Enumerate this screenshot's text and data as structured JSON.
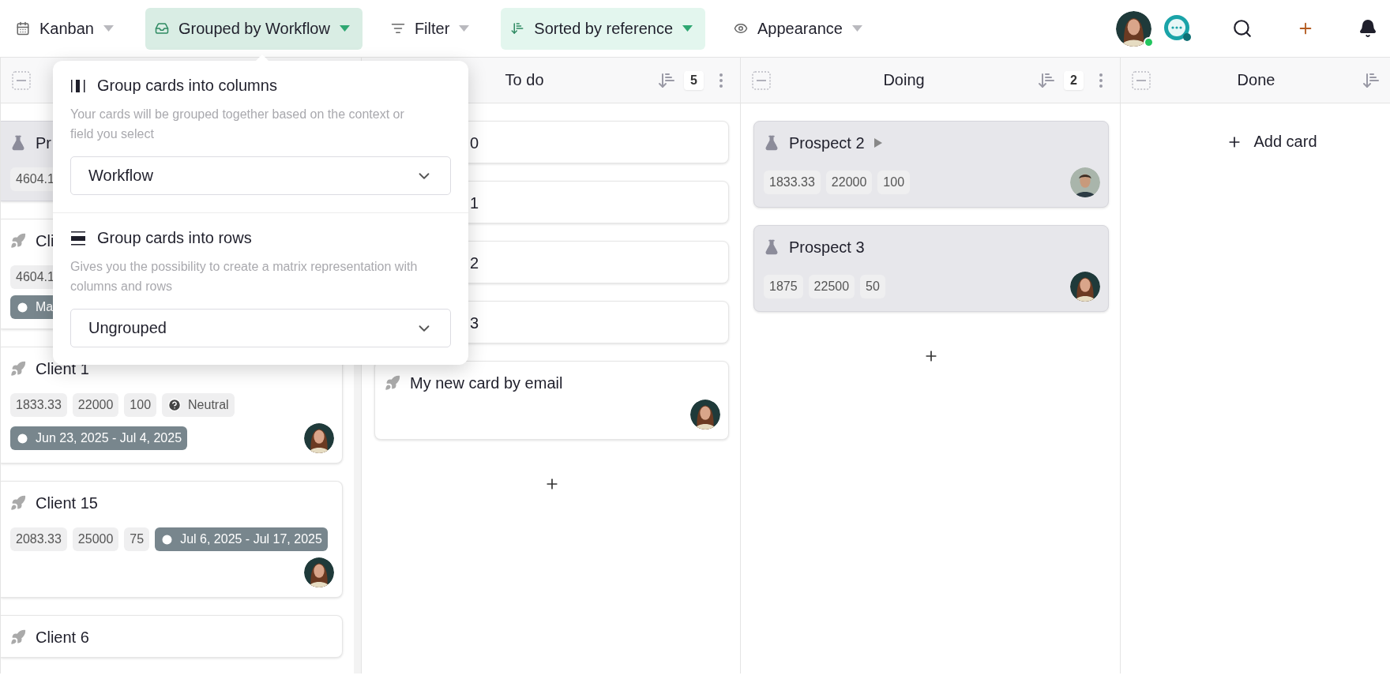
{
  "toolbar": {
    "items": [
      {
        "kind": "view",
        "label": "Kanban",
        "active": false
      },
      {
        "kind": "group",
        "label": "Grouped by Workflow",
        "active": true
      },
      {
        "kind": "filter",
        "label": "Filter",
        "active": false
      },
      {
        "kind": "sort",
        "label": "Sorted by reference",
        "active": true
      },
      {
        "kind": "appearance",
        "label": "Appearance",
        "active": false
      }
    ],
    "user": {
      "online": true
    }
  },
  "popup": {
    "sections": [
      {
        "kind": "columns",
        "title": "Group cards into columns",
        "description": "Your cards will be grouped together based on the context or field you select",
        "value": "Workflow"
      },
      {
        "kind": "rows",
        "title": "Group cards into rows",
        "description": "Gives you the possibility to create a matrix representation with columns and rows",
        "value": "Ungrouped"
      }
    ]
  },
  "columns": [
    {
      "cards": [
        {
          "kind": "prospect",
          "title": "Pr",
          "chip_rows": [
            [
              {
                "kind": "value",
                "text": "4604.1"
              }
            ]
          ]
        },
        {
          "kind": "client",
          "title": "Cli",
          "chip_rows": [
            [
              {
                "kind": "value",
                "text": "4604.1"
              }
            ],
            [
              {
                "kind": "date",
                "text": "Ma"
              }
            ]
          ]
        },
        {
          "kind": "client",
          "title": "Client 1",
          "chip_rows": [
            [
              {
                "kind": "value",
                "text": "1833.33"
              },
              {
                "kind": "value",
                "text": "22000"
              },
              {
                "kind": "value",
                "text": "100"
              },
              {
                "kind": "status",
                "text": "Neutral"
              }
            ],
            [
              {
                "kind": "date",
                "text": "Jun 23, 2025 - Jul 4, 2025"
              }
            ]
          ],
          "assignee": {
            "kind": "woman"
          }
        },
        {
          "kind": "client",
          "title": "Client 15",
          "chip_rows": [
            [
              {
                "kind": "value",
                "text": "2083.33"
              },
              {
                "kind": "value",
                "text": "25000"
              },
              {
                "kind": "value",
                "text": "75"
              },
              {
                "kind": "date",
                "text": "Jul 6, 2025 - Jul 17, 2025"
              }
            ]
          ],
          "assignee": {
            "kind": "woman",
            "below": true
          }
        },
        {
          "kind": "client",
          "title": "Client 6"
        }
      ]
    },
    {
      "collapse_hidden": true,
      "title": "To do",
      "count": "5",
      "cards": [
        {
          "kind": "client",
          "title": "0",
          "covered": true
        },
        {
          "kind": "client",
          "title": "1",
          "covered": true
        },
        {
          "kind": "client",
          "title": "2",
          "covered": true
        },
        {
          "kind": "client",
          "title": "3",
          "covered": true
        },
        {
          "kind": "client",
          "title": "My new card by email",
          "assignee": {
            "kind": "woman",
            "below": true
          }
        }
      ],
      "add_button": true
    },
    {
      "title": "Doing",
      "count": "2",
      "cards": [
        {
          "kind": "prospect",
          "title": "Prospect 2",
          "expand_arrow": true,
          "chip_rows": [
            [
              {
                "kind": "value",
                "text": "1833.33"
              },
              {
                "kind": "value",
                "text": "22000"
              },
              {
                "kind": "value",
                "text": "100"
              }
            ]
          ],
          "assignee": {
            "kind": "man"
          }
        },
        {
          "kind": "prospect",
          "title": "Prospect 3",
          "chip_rows": [
            [
              {
                "kind": "value",
                "text": "1875"
              },
              {
                "kind": "value",
                "text": "22500"
              },
              {
                "kind": "value",
                "text": "50"
              }
            ]
          ],
          "assignee": {
            "kind": "woman"
          }
        }
      ],
      "add_button": true
    },
    {
      "title": "Done",
      "add_label": "Add card"
    }
  ]
}
